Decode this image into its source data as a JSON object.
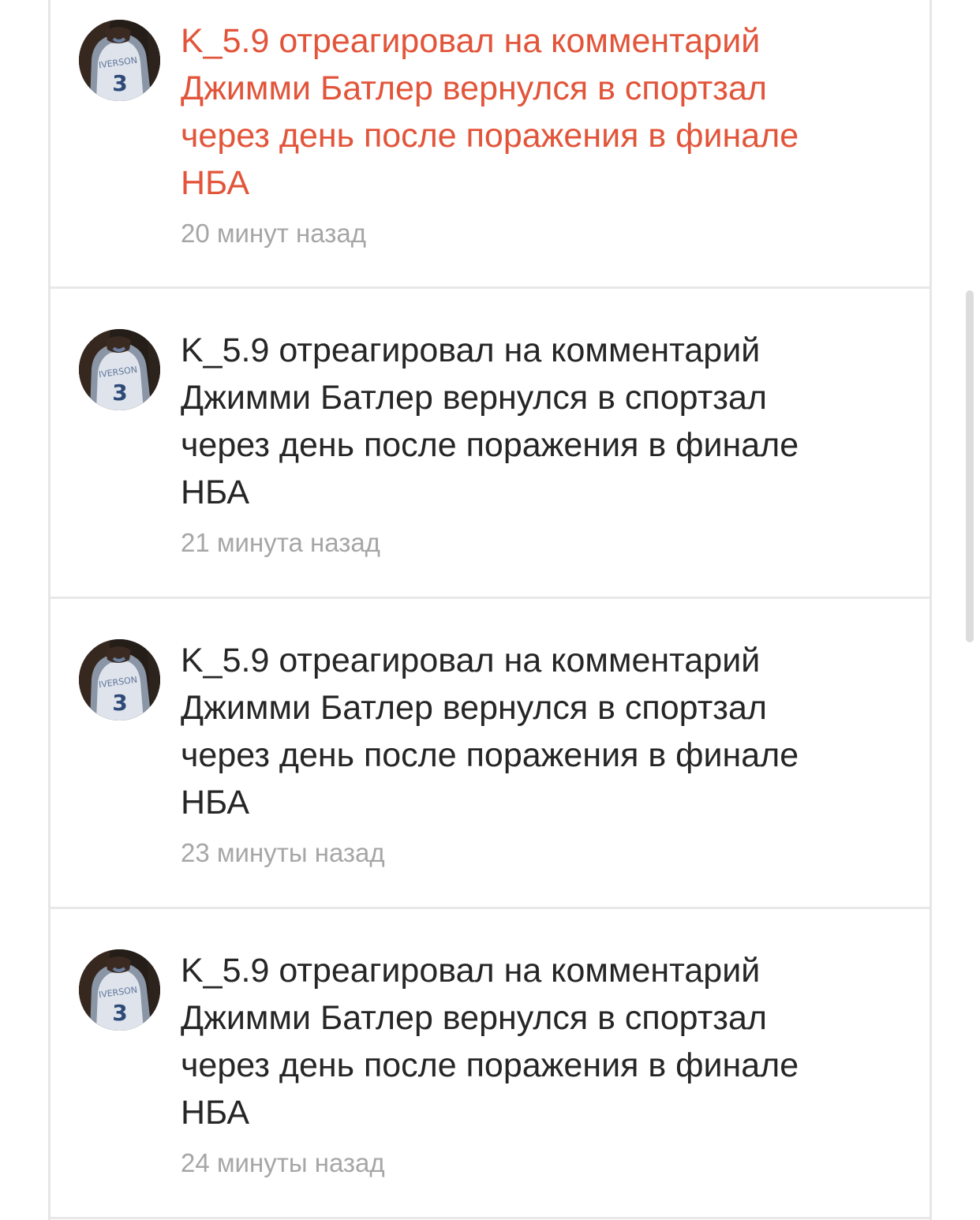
{
  "notifications": [
    {
      "line1": "K_5.9 отреагировал на комментарий",
      "line2": "Джимми Батлер вернулся в спортзал",
      "line3": "через день после поражения в финале",
      "line4": "НБА",
      "time": "20 минут назад",
      "unread": true
    },
    {
      "line1": "K_5.9 отреагировал на комментарий",
      "line2": "Джимми Батлер вернулся в спортзал",
      "line3": "через день после поражения в финале",
      "line4": "НБА",
      "time": "21 минута назад",
      "unread": false
    },
    {
      "line1": "K_5.9 отреагировал на комментарий",
      "line2": "Джимми Батлер вернулся в спортзал",
      "line3": "через день после поражения в финале",
      "line4": "НБА",
      "time": "23 минуты назад",
      "unread": false
    },
    {
      "line1": "K_5.9 отреагировал на комментарий",
      "line2": "Джимми Батлер вернулся в спортзал",
      "line3": "через день после поражения в финале",
      "line4": "НБА",
      "time": "24 минуты назад",
      "unread": false
    }
  ],
  "colors": {
    "unread_text": "#e2553a",
    "read_text": "#262626",
    "timestamp": "#a6a6a6",
    "divider": "#e8e8e8"
  },
  "avatar": {
    "icon": "user-avatar-jersey",
    "jersey_name": "IVERSON",
    "jersey_number": "3"
  }
}
